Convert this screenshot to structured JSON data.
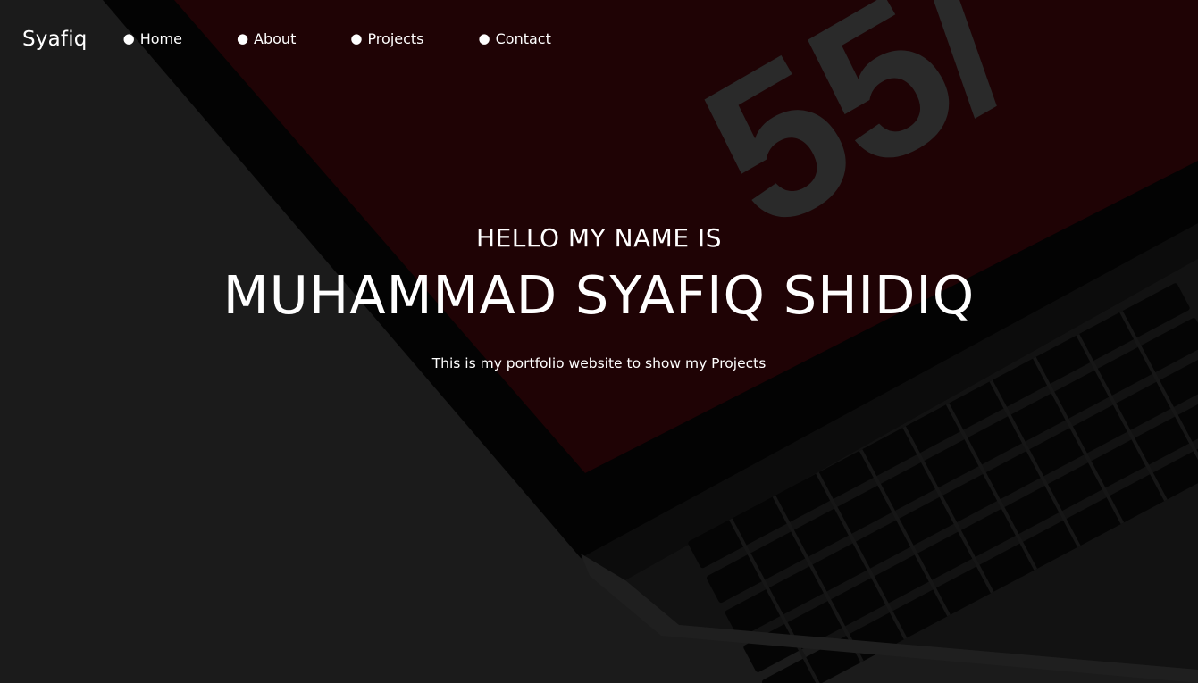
{
  "navbar": {
    "logo": "Syafiq",
    "bullet": "●",
    "items": [
      {
        "label": "Home"
      },
      {
        "label": "About"
      },
      {
        "label": "Projects"
      },
      {
        "label": "Contact"
      }
    ]
  },
  "hero": {
    "greeting": "HELLO MY NAME IS",
    "name": "MUHAMMAD SYAFIQ SHIDIQ",
    "tagline": "This is my portfolio website to show my Projects",
    "background_graphic_text": "55/"
  },
  "colors": {
    "background": "#1b1b1b",
    "screen_red": "#1f0305",
    "text": "#ffffff"
  }
}
